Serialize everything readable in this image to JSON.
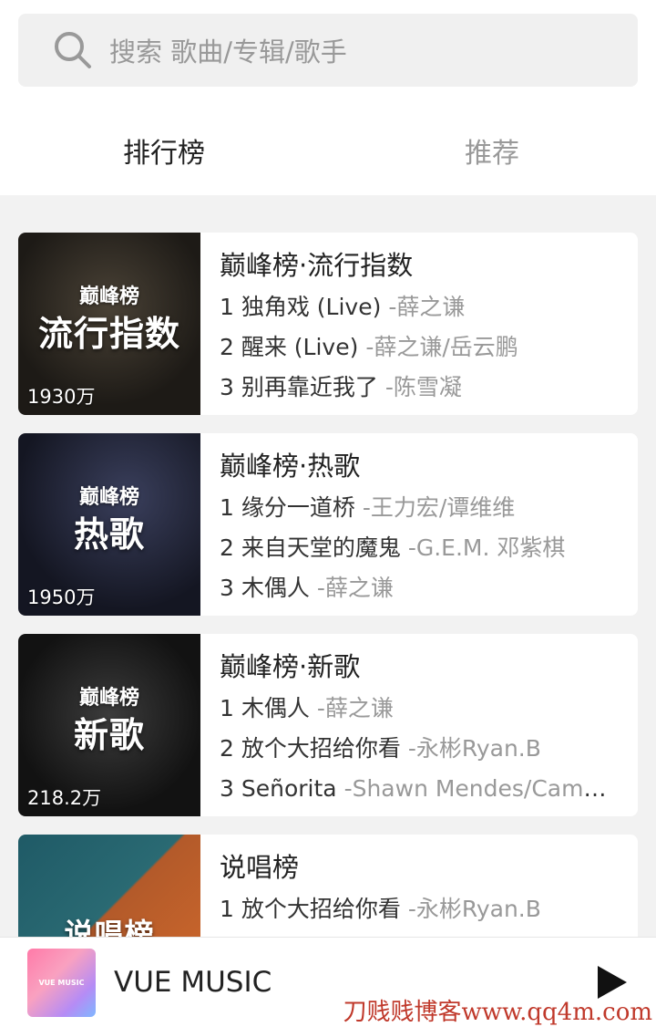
{
  "search": {
    "placeholder": "搜索 歌曲/专辑/歌手",
    "icon": "search-icon"
  },
  "tabs": [
    {
      "label": "排行榜",
      "active": true
    },
    {
      "label": "推荐",
      "active": false
    }
  ],
  "charts": [
    {
      "title": "巅峰榜·流行指数",
      "cover_main": "流行指数",
      "cover_brand": "巅峰榜",
      "play_count": "1930万",
      "songs": [
        {
          "rank": "1",
          "name": "独角戏 (Live)",
          "artist": "-薛之谦"
        },
        {
          "rank": "2",
          "name": "醒来 (Live)",
          "artist": "-薛之谦/岳云鹏"
        },
        {
          "rank": "3",
          "name": "别再靠近我了",
          "artist": "-陈雪凝"
        }
      ]
    },
    {
      "title": "巅峰榜·热歌",
      "cover_main": "热歌",
      "cover_brand": "巅峰榜",
      "play_count": "1950万",
      "songs": [
        {
          "rank": "1",
          "name": "缘分一道桥",
          "artist": "-王力宏/谭维维"
        },
        {
          "rank": "2",
          "name": "来自天堂的魔鬼",
          "artist": "-G.E.M. 邓紫棋"
        },
        {
          "rank": "3",
          "name": "木偶人",
          "artist": "-薛之谦"
        }
      ]
    },
    {
      "title": "巅峰榜·新歌",
      "cover_main": "新歌",
      "cover_brand": "巅峰榜",
      "play_count": "218.2万",
      "songs": [
        {
          "rank": "1",
          "name": "木偶人",
          "artist": "-薛之谦"
        },
        {
          "rank": "2",
          "name": "放个大招给你看",
          "artist": "-永彬Ryan.B"
        },
        {
          "rank": "3",
          "name": "Señorita",
          "artist": "-Shawn Mendes/Camila Cabello"
        }
      ]
    },
    {
      "title": "说唱榜",
      "cover_main": "说唱榜",
      "play_count": "",
      "songs": [
        {
          "rank": "1",
          "name": "放个大招给你看",
          "artist": "-永彬Ryan.B"
        }
      ]
    }
  ],
  "player": {
    "title": "VUE MUSIC",
    "thumb_text": "VUE MUSIC",
    "play_icon": "play-icon"
  },
  "watermark": "刀贱贱博客www.qq4m.com"
}
